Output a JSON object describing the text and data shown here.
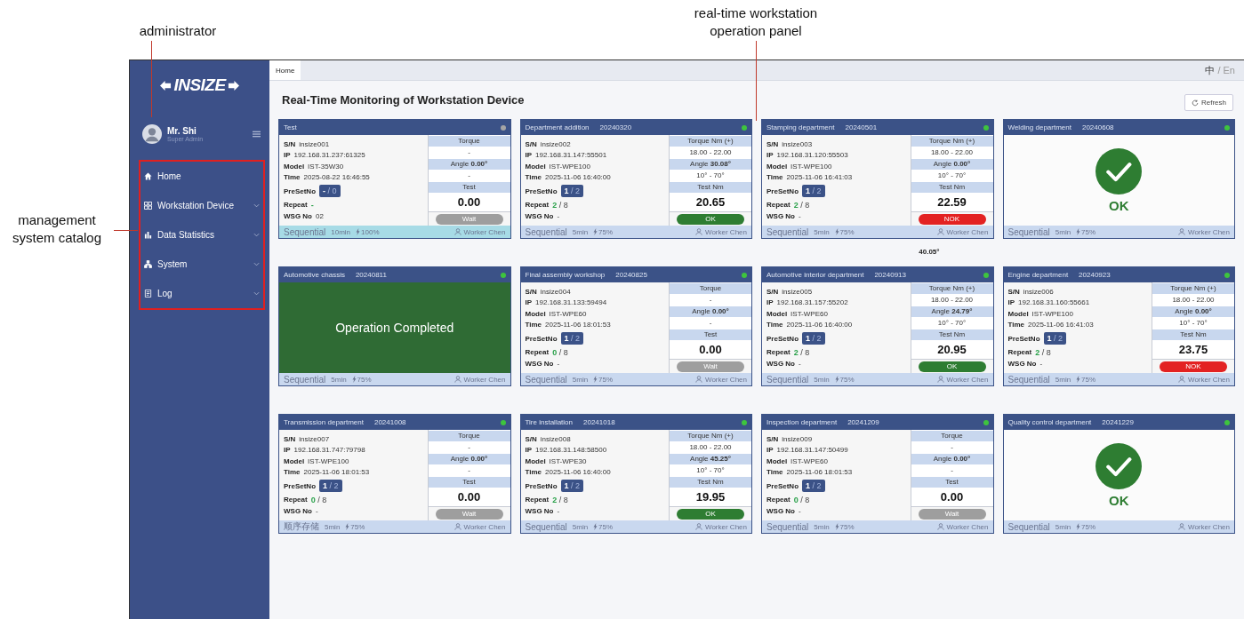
{
  "annotations": [
    {
      "kind": "admin",
      "text": "administrator"
    },
    {
      "kind": "panel",
      "text": "real-time workstation operation panel"
    },
    {
      "kind": "catalog",
      "text": "management system catalog"
    }
  ],
  "sidebar": {
    "logo": "INSIZE",
    "user": {
      "name": "Mr. Shi",
      "role": "Super Admin"
    },
    "items": [
      {
        "kind": "home",
        "label": "Home",
        "expandable": false
      },
      {
        "kind": "grid",
        "label": "Workstation Device",
        "expandable": true
      },
      {
        "kind": "chart",
        "label": "Data Statistics",
        "expandable": true
      },
      {
        "kind": "org",
        "label": "System",
        "expandable": true
      },
      {
        "kind": "log",
        "label": "Log",
        "expandable": true
      }
    ]
  },
  "tabs": [
    {
      "label": "Home",
      "selected": true
    }
  ],
  "language": {
    "separator": "/",
    "options": [
      {
        "label": "中",
        "selected": true
      },
      {
        "label": "En",
        "selected": false
      }
    ]
  },
  "title": "Real-Time Monitoring of Workstation Device",
  "refresh_button": "Refresh",
  "cards": [
    {
      "title": "Test",
      "online": false,
      "highlighted": true,
      "fields": [
        {
          "kind": "text",
          "label": "S/N",
          "value": "insize001"
        },
        {
          "kind": "text",
          "label": "IP",
          "value": "192.168.31.237:61325"
        },
        {
          "kind": "text",
          "label": "Model",
          "value": "IST-35W30"
        },
        {
          "kind": "text",
          "label": "Time",
          "value": "2025-08-22 16:46:55"
        },
        {
          "kind": "preset",
          "label": "PreSetNo",
          "current": "-",
          "rest": "/ 0"
        },
        {
          "kind": "repeat",
          "label": "Repeat",
          "current": "-"
        },
        {
          "kind": "text",
          "label": "WSG No",
          "value": "02"
        }
      ],
      "readings": {
        "torque_header": "Torque",
        "torque_value": "-",
        "angle_header": "Angle **0.00°**",
        "angle_range": "-",
        "test_header": "Test",
        "test_value": "0.00"
      },
      "result": {
        "kind": "wait",
        "label": "Wait"
      },
      "footer": {
        "mode": "Sequential",
        "duration": "10min",
        "power": "100%",
        "worker": "Worker Chen"
      }
    },
    {
      "title": "Department addition",
      "code": "20240320",
      "online": true,
      "highlighted": false,
      "fields": [
        {
          "kind": "text",
          "label": "S/N",
          "value": "insize002"
        },
        {
          "kind": "text",
          "label": "IP",
          "value": "192.168.31.147:55501"
        },
        {
          "kind": "text",
          "label": "Model",
          "value": "IST-WPE100"
        },
        {
          "kind": "text",
          "label": "Time",
          "value": "2025-11-06 16:40:00"
        },
        {
          "kind": "preset",
          "label": "PreSetNo",
          "current": "1",
          "rest": "/ 2"
        },
        {
          "kind": "repeat",
          "label": "Repeat",
          "current": "2",
          "rest": "/ 8"
        },
        {
          "kind": "text",
          "label": "WSG No",
          "value": "-"
        }
      ],
      "readings": {
        "torque_header": "Torque Nm (+)",
        "torque_value": "18.00 - 22.00",
        "angle_header": "Angle **30.08°**",
        "angle_range": "10° - 70°",
        "test_header": "Test Nm",
        "test_value": "20.65"
      },
      "result": {
        "kind": "ok",
        "label": "OK"
      },
      "footer": {
        "mode": "Sequential",
        "duration": "5min",
        "power": "75%",
        "worker": "Worker Chen"
      }
    },
    {
      "title": "Stamping department",
      "code": "20240501",
      "online": true,
      "highlighted": false,
      "note": "40.05°",
      "fields": [
        {
          "kind": "text",
          "label": "S/N",
          "value": "insize003"
        },
        {
          "kind": "text",
          "label": "IP",
          "value": "192.168.31.120:55503"
        },
        {
          "kind": "text",
          "label": "Model",
          "value": "IST-WPE100"
        },
        {
          "kind": "text",
          "label": "Time",
          "value": "2025-11-06 16:41:03"
        },
        {
          "kind": "preset",
          "label": "PreSetNo",
          "current": "1",
          "rest": "/ 2"
        },
        {
          "kind": "repeat",
          "label": "Repeat",
          "current": "2",
          "rest": "/ 8"
        },
        {
          "kind": "text",
          "label": "WSG No",
          "value": "-"
        }
      ],
      "readings": {
        "torque_header": "Torque Nm (+)",
        "torque_value": "18.00 - 22.00",
        "angle_header": "Angle **0.00°**",
        "angle_range": "10° - 70°",
        "test_header": "Test Nm",
        "test_value": "22.59"
      },
      "result": {
        "kind": "nok",
        "label": "NOK"
      },
      "footer": {
        "mode": "Sequential",
        "duration": "5min",
        "power": "75%",
        "worker": "Worker Chen"
      }
    },
    {
      "title": "Welding department",
      "code": "20240608",
      "online": true,
      "highlighted": false,
      "overlay": {
        "kind": "ok",
        "text": "OK"
      },
      "footer": {
        "mode": "Sequential",
        "duration": "5min",
        "power": "75%",
        "worker": "Worker Chen"
      }
    },
    {
      "title": "Automotive chassis",
      "code": "20240811",
      "online": true,
      "highlighted": false,
      "overlay": {
        "kind": "completed",
        "text": "Operation Completed"
      },
      "footer": {
        "mode": "Sequential",
        "duration": "5min",
        "power": "75%",
        "worker": "Worker Chen"
      }
    },
    {
      "title": "Final assembly workshop",
      "code": "20240825",
      "online": true,
      "highlighted": false,
      "fields": [
        {
          "kind": "text",
          "label": "S/N",
          "value": "insize004"
        },
        {
          "kind": "text",
          "label": "IP",
          "value": "192.168.31.133:59494"
        },
        {
          "kind": "text",
          "label": "Model",
          "value": "IST-WPE60"
        },
        {
          "kind": "text",
          "label": "Time",
          "value": "2025-11-06 18:01:53"
        },
        {
          "kind": "preset",
          "label": "PreSetNo",
          "current": "1",
          "rest": "/ 2"
        },
        {
          "kind": "repeat",
          "label": "Repeat",
          "current": "0",
          "rest": "/ 8"
        },
        {
          "kind": "text",
          "label": "WSG No",
          "value": "-"
        }
      ],
      "readings": {
        "torque_header": "Torque",
        "torque_value": "-",
        "angle_header": "Angle **0.00°**",
        "angle_range": "-",
        "test_header": "Test",
        "test_value": "0.00"
      },
      "result": {
        "kind": "wait",
        "label": "Wait"
      },
      "footer": {
        "mode": "Sequential",
        "duration": "5min",
        "power": "75%",
        "worker": "Worker Chen"
      }
    },
    {
      "title": "Automotive interior department",
      "code": "20240913",
      "online": true,
      "highlighted": false,
      "fields": [
        {
          "kind": "text",
          "label": "S/N",
          "value": "insize005"
        },
        {
          "kind": "text",
          "label": "IP",
          "value": "192.168.31.157:55202"
        },
        {
          "kind": "text",
          "label": "Model",
          "value": "IST-WPE60"
        },
        {
          "kind": "text",
          "label": "Time",
          "value": "2025-11-06 16:40:00"
        },
        {
          "kind": "preset",
          "label": "PreSetNo",
          "current": "1",
          "rest": "/ 2"
        },
        {
          "kind": "repeat",
          "label": "Repeat",
          "current": "2",
          "rest": "/ 8"
        },
        {
          "kind": "text",
          "label": "WSG No",
          "value": "-"
        }
      ],
      "readings": {
        "torque_header": "Torque Nm (+)",
        "torque_value": "18.00 - 22.00",
        "angle_header": "Angle **24.79°**",
        "angle_range": "10° - 70°",
        "test_header": "Test Nm",
        "test_value": "20.95"
      },
      "result": {
        "kind": "ok",
        "label": "OK"
      },
      "footer": {
        "mode": "Sequential",
        "duration": "5min",
        "power": "75%",
        "worker": "Worker Chen"
      }
    },
    {
      "title": "Engine department",
      "code": "20240923",
      "online": true,
      "highlighted": false,
      "fields": [
        {
          "kind": "text",
          "label": "S/N",
          "value": "insize006"
        },
        {
          "kind": "text",
          "label": "IP",
          "value": "192.168.31.160:55661"
        },
        {
          "kind": "text",
          "label": "Model",
          "value": "IST-WPE100"
        },
        {
          "kind": "text",
          "label": "Time",
          "value": "2025-11-06 16:41:03"
        },
        {
          "kind": "preset",
          "label": "PreSetNo",
          "current": "1",
          "rest": "/ 2"
        },
        {
          "kind": "repeat",
          "label": "Repeat",
          "current": "2",
          "rest": "/ 8"
        },
        {
          "kind": "text",
          "label": "WSG No",
          "value": "-"
        }
      ],
      "readings": {
        "torque_header": "Torque Nm (+)",
        "torque_value": "18.00 - 22.00",
        "angle_header": "Angle **0.00°**",
        "angle_range": "10° - 70°",
        "test_header": "Test Nm",
        "test_value": "23.75"
      },
      "result": {
        "kind": "nok",
        "label": "NOK"
      },
      "footer": {
        "mode": "Sequential",
        "duration": "5min",
        "power": "75%",
        "worker": "Worker Chen"
      }
    },
    {
      "title": "Transmission department",
      "code": "20241008",
      "online": true,
      "highlighted": false,
      "fields": [
        {
          "kind": "text",
          "label": "S/N",
          "value": "insize007"
        },
        {
          "kind": "text",
          "label": "IP",
          "value": "192.168.31.747:79798"
        },
        {
          "kind": "text",
          "label": "Model",
          "value": "IST-WPE100"
        },
        {
          "kind": "text",
          "label": "Time",
          "value": "2025-11-06 18:01:53"
        },
        {
          "kind": "preset",
          "label": "PreSetNo",
          "current": "1",
          "rest": "/ 2"
        },
        {
          "kind": "repeat",
          "label": "Repeat",
          "current": "0",
          "rest": "/ 8"
        },
        {
          "kind": "text",
          "label": "WSG No",
          "value": "-"
        }
      ],
      "readings": {
        "torque_header": "Torque",
        "torque_value": "-",
        "angle_header": "Angle **0.00°**",
        "angle_range": "-",
        "test_header": "Test",
        "test_value": "0.00"
      },
      "result": {
        "kind": "wait",
        "label": "Wait"
      },
      "footer": {
        "mode": "顺序存储",
        "duration": "5min",
        "power": "75%",
        "worker": "Worker Chen"
      }
    },
    {
      "title": "Tire installation",
      "code": "20241018",
      "online": true,
      "highlighted": false,
      "fields": [
        {
          "kind": "text",
          "label": "S/N",
          "value": "insize008"
        },
        {
          "kind": "text",
          "label": "IP",
          "value": "192.168.31.148:58500"
        },
        {
          "kind": "text",
          "label": "Model",
          "value": "IST-WPE30"
        },
        {
          "kind": "text",
          "label": "Time",
          "value": "2025-11-06 16:40:00"
        },
        {
          "kind": "preset",
          "label": "PreSetNo",
          "current": "1",
          "rest": "/ 2"
        },
        {
          "kind": "repeat",
          "label": "Repeat",
          "current": "2",
          "rest": "/ 8"
        },
        {
          "kind": "text",
          "label": "WSG No",
          "value": "-"
        }
      ],
      "readings": {
        "torque_header": "Torque Nm (+)",
        "torque_value": "18.00 - 22.00",
        "angle_header": "Angle **45.25°**",
        "angle_range": "10° - 70°",
        "test_header": "Test Nm",
        "test_value": "19.95"
      },
      "result": {
        "kind": "ok",
        "label": "OK"
      },
      "footer": {
        "mode": "Sequential",
        "duration": "5min",
        "power": "75%",
        "worker": "Worker Chen"
      }
    },
    {
      "title": "Inspection department",
      "code": "20241209",
      "online": true,
      "highlighted": false,
      "fields": [
        {
          "kind": "text",
          "label": "S/N",
          "value": "insize009"
        },
        {
          "kind": "text",
          "label": "IP",
          "value": "192.168.31.147:50499"
        },
        {
          "kind": "text",
          "label": "Model",
          "value": "IST-WPE60"
        },
        {
          "kind": "text",
          "label": "Time",
          "value": "2025-11-06 18:01:53"
        },
        {
          "kind": "preset",
          "label": "PreSetNo",
          "current": "1",
          "rest": "/ 2"
        },
        {
          "kind": "repeat",
          "label": "Repeat",
          "current": "0",
          "rest": "/ 8"
        },
        {
          "kind": "text",
          "label": "WSG No",
          "value": "-"
        }
      ],
      "readings": {
        "torque_header": "Torque",
        "torque_value": "-",
        "angle_header": "Angle **0.00°**",
        "angle_range": "-",
        "test_header": "Test",
        "test_value": "0.00"
      },
      "result": {
        "kind": "wait",
        "label": "Wait"
      },
      "footer": {
        "mode": "Sequential",
        "duration": "5min",
        "power": "75%",
        "worker": "Worker Chen"
      }
    },
    {
      "title": "Quality control department",
      "code": "20241229",
      "online": true,
      "highlighted": false,
      "overlay": {
        "kind": "ok",
        "text": "OK"
      },
      "footer": {
        "mode": "Sequential",
        "duration": "5min",
        "power": "75%",
        "worker": "Worker Chen"
      }
    }
  ]
}
